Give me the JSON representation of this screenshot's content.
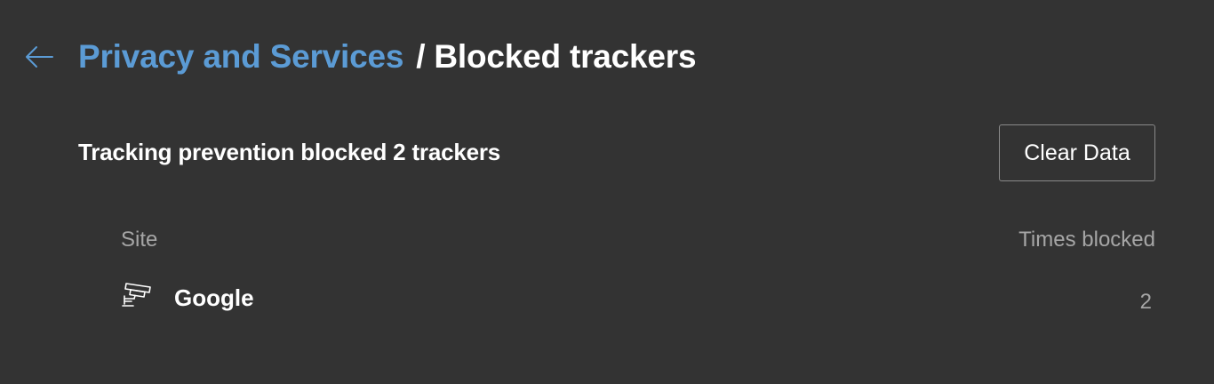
{
  "header": {
    "back_icon": "arrow-left-icon",
    "parent_label": "Privacy and Services",
    "separator": "/",
    "current_label": "Blocked trackers"
  },
  "summary": {
    "text": "Tracking prevention blocked 2 trackers",
    "clear_button_label": "Clear Data"
  },
  "table": {
    "columns": [
      "Site",
      "Times blocked"
    ],
    "rows": [
      {
        "icon": "tracker-camera-icon",
        "site": "Google",
        "times_blocked": "2"
      }
    ]
  },
  "colors": {
    "background": "#333333",
    "accent_link": "#5b9bd5",
    "text_primary": "#ffffff",
    "text_secondary": "#a6a6a6",
    "button_border": "#8a8a8a"
  }
}
